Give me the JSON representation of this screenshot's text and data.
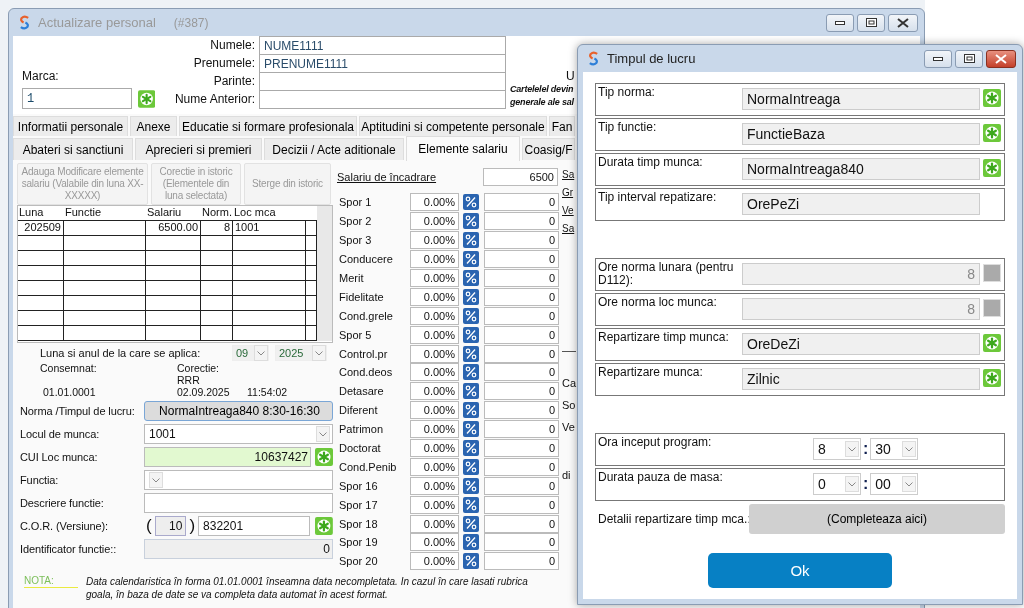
{
  "main_window": {
    "title": "Actualizare personal",
    "record_number": "(#387)"
  },
  "header": {
    "marca": {
      "label": "Marca:",
      "value": "1"
    },
    "name_fields": [
      {
        "label": "Numele:",
        "value": "NUME1111"
      },
      {
        "label": "Prenumele:",
        "value": "PRENUME1111"
      },
      {
        "label": "Parinte:"
      },
      {
        "label": "Nume Anterior:"
      }
    ],
    "side_text": "U",
    "notice_lines": [
      "Cartelelel devin",
      "generale ale sal"
    ]
  },
  "tabs_row_1": [
    {
      "label": "Informatii personale",
      "selected": false
    },
    {
      "label": "Anexe",
      "selected": false
    },
    {
      "label": "Educatie si formare profesionala",
      "selected": false
    },
    {
      "label": "Aptitudini si competente personale",
      "selected": false
    },
    {
      "label": "Fan",
      "selected": false
    }
  ],
  "tabs_row_2": [
    {
      "label": "Abateri si sanctiuni",
      "selected": false
    },
    {
      "label": "Aprecieri si premieri",
      "selected": false
    },
    {
      "label": "Decizii / Acte aditionale",
      "selected": false
    },
    {
      "label": "Elemente salariu",
      "selected": true
    },
    {
      "label": "Coasig/F",
      "selected": false
    }
  ],
  "history_buttons": [
    {
      "label": "Adauga Modificare elemente salariu (Valabile din luna XX-XXXXX)",
      "disabled": true
    },
    {
      "label": "Corectie in istoric (Elementele din luna selectata)",
      "disabled": true
    },
    {
      "label": "Sterge din istoric",
      "disabled": true
    }
  ],
  "history_table": {
    "columns": [
      "Luna",
      "Functie",
      "Salariu",
      "Norm.",
      "Loc mca"
    ],
    "rows": [
      {
        "luna": "202509",
        "salariu": "6500.00",
        "norm": "8",
        "loc_mca": "1001"
      }
    ]
  },
  "apply_period": {
    "label": "Luna si anul de la care se aplica:",
    "month": "09",
    "year": "2025"
  },
  "audit": {
    "consemnat_label": "Consemnat:",
    "consemnat_date": "01.01.0001",
    "corectie_label": "Corectie:",
    "corectie_user": "RRR",
    "corectie_date": "02.09.2025",
    "corectie_time": "11:54:02"
  },
  "job_fields": [
    {
      "kind": "button",
      "label": "Norma /Timpul de lucru:",
      "value": "NormaIntreaga840  8:30-16:30"
    },
    {
      "kind": "combo",
      "label": "Locul de munca:",
      "value": "1001"
    },
    {
      "kind": "lookup",
      "label": "CUI Loc munca:",
      "value": "10637427"
    },
    {
      "kind": "combo",
      "label": "Functia:"
    },
    {
      "kind": "text",
      "label": "Descriere functie:"
    },
    {
      "kind": "cor",
      "label": "C.O.R. (Versiune):",
      "open": "(",
      "version": "10",
      "close": ")",
      "value": "832201"
    },
    {
      "kind": "readonly",
      "label": "Identificator functie::",
      "value": "0"
    }
  ],
  "note": {
    "label": "NOTA:",
    "text": "Data calendaristica în forma 01.01.0001 înseamna data necompletata. In cazul în care lasati rubrica goala, în baza de date se va completa data automat în acest format."
  },
  "salary": {
    "label": "Salariu de încadrare",
    "value": "6500"
  },
  "spor_rows": [
    {
      "label": "Spor 1",
      "percent": "0.00%",
      "amount": "0"
    },
    {
      "label": "Spor 2",
      "percent": "0.00%",
      "amount": "0"
    },
    {
      "label": "Spor 3",
      "percent": "0.00%",
      "amount": "0"
    },
    {
      "label": "Conducere",
      "percent": "0.00%",
      "amount": "0"
    },
    {
      "label": "Merit",
      "percent": "0.00%",
      "amount": "0"
    },
    {
      "label": "Fidelitate",
      "percent": "0.00%",
      "amount": "0"
    },
    {
      "label": "Cond.grele",
      "percent": "0.00%",
      "amount": "0"
    },
    {
      "label": "Spor 5",
      "percent": "0.00%",
      "amount": "0"
    },
    {
      "label": "Control.pr",
      "percent": "0.00%",
      "amount": "0"
    },
    {
      "label": "Cond.deos",
      "percent": "0.00%",
      "amount": "0"
    },
    {
      "label": "Detasare",
      "percent": "0.00%",
      "amount": "0"
    },
    {
      "label": "Diferent",
      "percent": "0.00%",
      "amount": "0"
    },
    {
      "label": "Patrimon",
      "percent": "0.00%",
      "amount": "0"
    },
    {
      "label": "Doctorat",
      "percent": "0.00%",
      "amount": "0"
    },
    {
      "label": "Cond.Penib",
      "percent": "0.00%",
      "amount": "0"
    },
    {
      "label": "Spor 16",
      "percent": "0.00%",
      "amount": "0"
    },
    {
      "label": "Spor 17",
      "percent": "0.00%",
      "amount": "0"
    },
    {
      "label": "Spor 18",
      "percent": "0.00%",
      "amount": "0"
    },
    {
      "label": "Spor 19",
      "percent": "0.00%",
      "amount": "0"
    },
    {
      "label": "Spor 20",
      "percent": "0.00%",
      "amount": "0"
    }
  ],
  "side_links": [
    "Sa",
    "Gr",
    "Ve",
    "Sa"
  ],
  "side_labels": [
    "Ca",
    "So",
    "Ve",
    "di"
  ],
  "dialog": {
    "title": "Timpul de lucru",
    "groups": [
      [
        {
          "kind": "choice",
          "label": "Tip norma:",
          "value": "NormaIntreaga",
          "button_disabled": false
        },
        {
          "kind": "choice",
          "label": "Tip functie:",
          "value": "FunctieBaza",
          "button_disabled": false
        },
        {
          "kind": "choice",
          "label": "Durata timp munca:",
          "value": "NormaIntreaga840",
          "button_disabled": false
        },
        {
          "kind": "choice",
          "label": "Tip interval repatizare:",
          "value": "OrePeZi"
        }
      ],
      [
        {
          "kind": "number",
          "label": "Ore norma lunara (pentru D112):",
          "value": "8",
          "disabled": true,
          "button_disabled": true
        },
        {
          "kind": "number",
          "label": "Ore norma loc munca:",
          "value": "8",
          "disabled": true,
          "button_disabled": true
        },
        {
          "kind": "choice",
          "label": "Repartizare timp munca:",
          "value": "OreDeZi",
          "button_disabled": false
        },
        {
          "kind": "choice",
          "label": "Repartizare munca:",
          "value": "Zilnic",
          "button_disabled": false
        }
      ],
      [
        {
          "kind": "time",
          "label": "Ora inceput program:",
          "hour": "8",
          "separator": ":",
          "minute": "30"
        },
        {
          "kind": "time",
          "label": "Durata pauza de masa:",
          "hour": "0",
          "separator": ":",
          "minute": "00"
        }
      ]
    ],
    "details": {
      "label": "Detalii repartizare timp mca.:",
      "button": "(Completeaza aici)"
    },
    "ok": "Ok"
  }
}
